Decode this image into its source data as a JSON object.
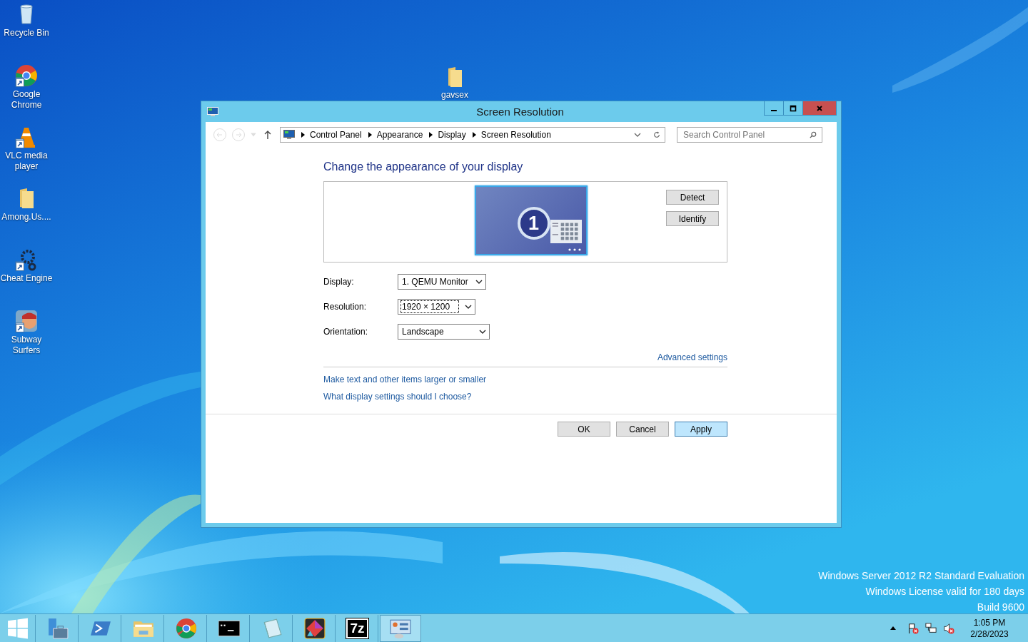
{
  "desktop_icons": [
    {
      "label": "Recycle Bin",
      "kind": "bin",
      "shortcut": false
    },
    {
      "label": "Google Chrome",
      "kind": "chrome",
      "shortcut": true
    },
    {
      "label": "VLC media player",
      "kind": "vlc",
      "shortcut": true
    },
    {
      "label": "Among.Us....",
      "kind": "folder",
      "shortcut": false
    },
    {
      "label": "Cheat Engine",
      "kind": "gear",
      "shortcut": true
    },
    {
      "label": "Subway Surfers",
      "kind": "game",
      "shortcut": true
    }
  ],
  "behind_window_icon": {
    "label": "gavsex",
    "kind": "folder"
  },
  "window": {
    "title": "Screen Resolution",
    "breadcrumb": [
      "Control Panel",
      "Appearance",
      "Display",
      "Screen Resolution"
    ],
    "search": {
      "placeholder": "Search Control Panel"
    },
    "heading": "Change the appearance of your display",
    "monitor": {
      "number": "1",
      "selected": true
    },
    "side_buttons": [
      "Detect",
      "Identify"
    ],
    "fields": [
      {
        "label": "Display:",
        "value": "1. QEMU Monitor",
        "focused": false
      },
      {
        "label": "Resolution:",
        "value": "1920 × 1200",
        "focused": true
      },
      {
        "label": "Orientation:",
        "value": "Landscape",
        "focused": false
      }
    ],
    "advanced_link": "Advanced settings",
    "links": [
      "Make text and other items larger or smaller",
      "What display settings should I choose?"
    ],
    "buttons": [
      {
        "label": "OK",
        "hovered": false
      },
      {
        "label": "Cancel",
        "hovered": false
      },
      {
        "label": "Apply",
        "hovered": true
      }
    ]
  },
  "watermark_lines": [
    "Windows Server 2012 R2 Standard Evaluation",
    "Windows License valid for 180 days",
    "Build 9600"
  ],
  "taskbar": {
    "apps": [
      {
        "kind": "start",
        "selected": false
      },
      {
        "kind": "server",
        "selected": false
      },
      {
        "kind": "powershell",
        "selected": false
      },
      {
        "kind": "explorer",
        "selected": false
      },
      {
        "kind": "chrome",
        "selected": false
      },
      {
        "kind": "cmd",
        "selected": false
      },
      {
        "kind": "notepad",
        "selected": false
      },
      {
        "kind": "paint",
        "selected": false
      },
      {
        "kind": "archive",
        "label": "7z",
        "selected": false
      },
      {
        "kind": "control",
        "selected": true
      }
    ],
    "time": "1:05 PM",
    "date": "2/28/2023"
  }
}
